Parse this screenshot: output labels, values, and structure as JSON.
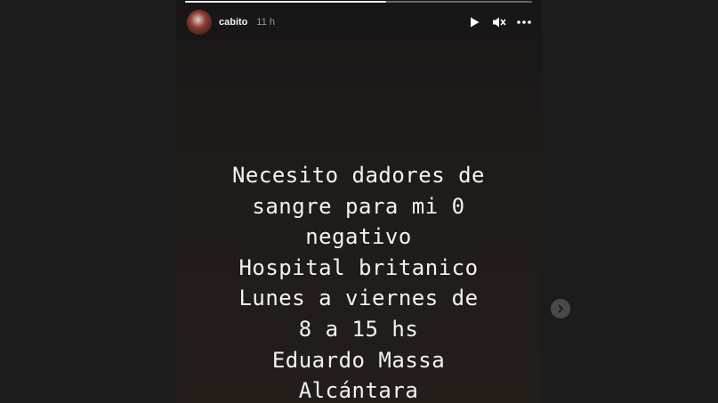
{
  "story": {
    "username": "cabito",
    "timestamp": "11 h",
    "progress": 0.58,
    "lines": [
      "Necesito dadores de",
      "sangre para mi 0",
      "negativo",
      "Hospital britanico",
      "Lunes a viernes de",
      "8 a 15 hs",
      "Eduardo Massa",
      "Alcántara"
    ]
  },
  "icons": {
    "play": "play-icon",
    "mute": "muted-speaker-icon",
    "more": "more-options-icon",
    "next": "chevron-right-icon"
  },
  "colors": {
    "page_background": "#1c1c1c",
    "story_background": "#1f1b19",
    "text": "#f3f3f3",
    "muted_text": "#9a9a9a",
    "next_button": "#4a4a4a"
  }
}
